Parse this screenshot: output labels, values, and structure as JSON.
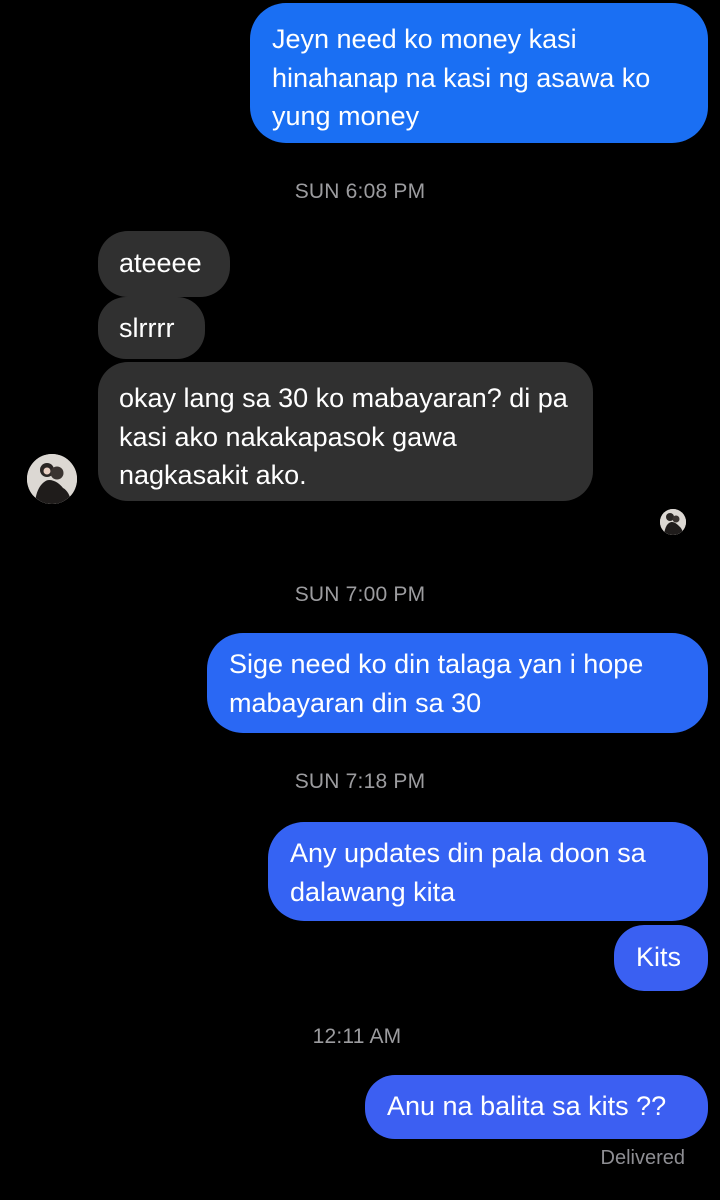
{
  "thread": {
    "messages": [
      {
        "direction": "outgoing",
        "text": "Jeyn need ko money kasi hinahanap na kasi ng asawa ko yung money"
      },
      {
        "type": "timestamp",
        "text": "SUN 6:08 PM"
      },
      {
        "direction": "incoming",
        "text": "ateeee"
      },
      {
        "direction": "incoming",
        "text": "slrrrr"
      },
      {
        "direction": "incoming",
        "text": "okay lang sa 30 ko mabayaran? di pa kasi ako nakakapasok gawa nagkasakit ako."
      },
      {
        "type": "timestamp",
        "text": "SUN 7:00 PM"
      },
      {
        "direction": "outgoing",
        "text": "Sige need ko din talaga yan i hope mabayaran din sa 30"
      },
      {
        "type": "timestamp",
        "text": "SUN 7:18 PM"
      },
      {
        "direction": "outgoing",
        "text": "Any updates din pala doon sa dalawang kita"
      },
      {
        "direction": "outgoing",
        "text": "Kits"
      },
      {
        "type": "timestamp",
        "text": "12:11 AM"
      },
      {
        "direction": "outgoing",
        "text": "Anu na balita sa kits ??"
      }
    ],
    "status": "Delivered"
  },
  "avatars": {
    "sender_avatar_icon": "person-avatar-icon",
    "read_receipt_icon": "read-receipt-avatar-icon"
  },
  "colors": {
    "background": "#000000",
    "incoming_bubble": "#303030",
    "outgoing_bubble_top": "#1a6ff4",
    "outgoing_bubble_bottom": "#3a60f2",
    "timestamp_text": "#9c9c9f",
    "status_text": "#8e8e93"
  }
}
